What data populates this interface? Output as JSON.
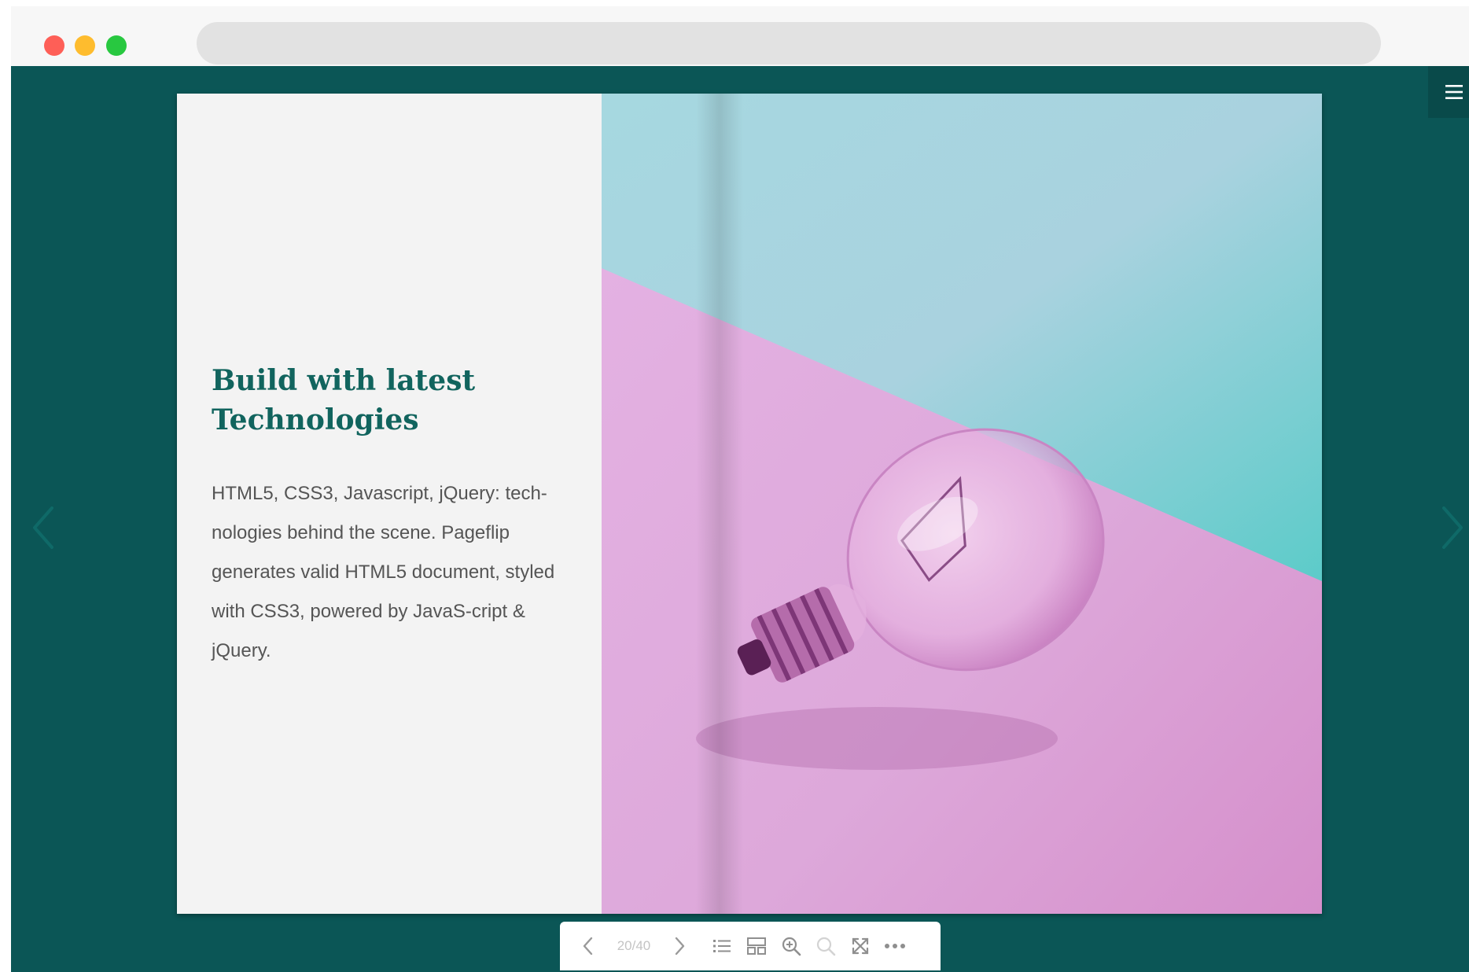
{
  "window": {
    "controls": [
      "close",
      "minimize",
      "maximize"
    ],
    "address_bar": ""
  },
  "viewer": {
    "background_color": "#0b5656",
    "menu_icon": "hamburger-menu-icon",
    "prev_page_icon": "chevron-left-icon",
    "next_page_icon": "chevron-right-icon"
  },
  "page": {
    "headline_line1": "Build with latest",
    "headline_line2": "Technologies",
    "body": "HTML5, CSS3, Javascript, jQuery: tech-nologies behind the scene. Pageflip generates valid HTML5 document, styled with CSS3, powered by JavaS-cript & jQuery.",
    "headline_color": "#11645e",
    "photo": "light-bulb-on-pink-and-teal-background"
  },
  "toolbar": {
    "page_counter": "20/40",
    "icons": [
      "chevron-left-icon",
      "chevron-right-icon",
      "list-icon",
      "thumbnails-icon",
      "zoom-in-icon",
      "zoom-out-icon",
      "fullscreen-icon",
      "more-icon"
    ]
  }
}
